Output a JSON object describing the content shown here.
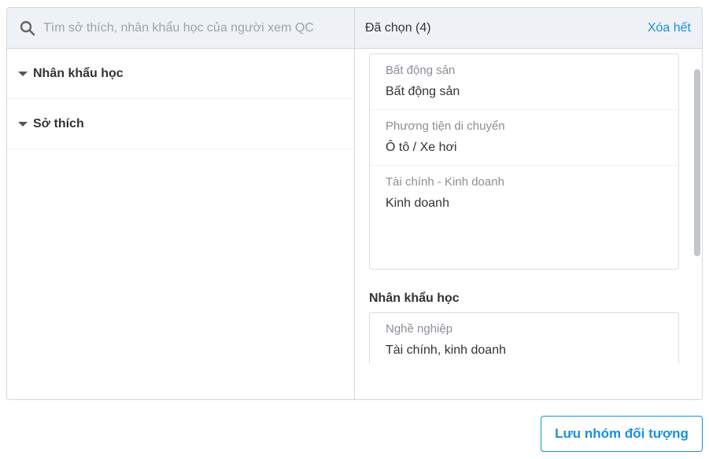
{
  "search": {
    "placeholder": "Tìm sở thích, nhân khẩu học của người xem QC",
    "icon": "search-icon"
  },
  "categories": [
    {
      "label": "Nhân khẩu học",
      "icon": "caret-down-icon"
    },
    {
      "label": "Sở thích",
      "icon": "caret-down-icon"
    }
  ],
  "selected": {
    "title": "Đã chọn (4)",
    "clear_label": "Xóa hết",
    "groups": [
      {
        "heading": "",
        "items": [
          {
            "category": "Bất động sản",
            "value": "Bất động sản"
          },
          {
            "category": "Phương tiện di chuyển",
            "value": "Ô tô / Xe hơi"
          },
          {
            "category": "Tài chính - Kinh doanh",
            "value": "Kinh doanh"
          }
        ]
      },
      {
        "heading": "Nhân khẩu học",
        "items": [
          {
            "category": "Nghề nghiệp",
            "value": "Tài chính, kinh doanh"
          }
        ]
      }
    ]
  },
  "save_label": "Lưu nhóm đối tượng",
  "colors": {
    "accent": "#1a90d9",
    "header_bg": "#eef2f6",
    "border": "#d3d8de"
  }
}
